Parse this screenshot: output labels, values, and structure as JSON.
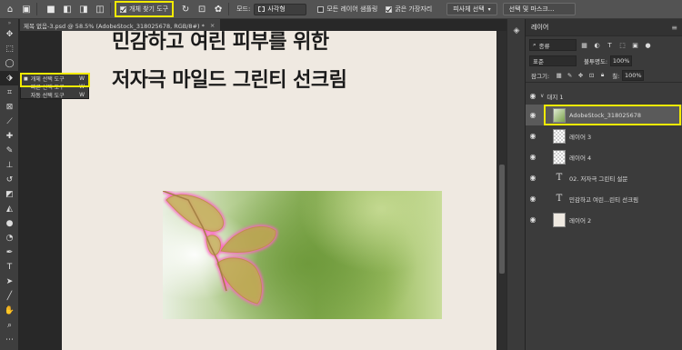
{
  "options_bar": {
    "object_finder_label": "개체 찾기 도구",
    "mode_label": "모드:",
    "mode_value": "사각형",
    "sample_all_layers_label": "모든 레이어 샘플링",
    "hard_edge_label": "굵은 가장자리",
    "subject_select_label": "피사체 선택",
    "select_mask_label": "선택 및 마스크..."
  },
  "document_tab": {
    "title": "제목 없음-3.psd @ 58.5% (AdobeStock_318025678, RGB/8#) *"
  },
  "tool_flyout": {
    "items": [
      {
        "label": "개체 선택 도구",
        "key": "W"
      },
      {
        "label": "빠른 선택 도구",
        "key": "W"
      },
      {
        "label": "자동 선택 도구",
        "key": "W"
      }
    ]
  },
  "canvas": {
    "line1": "민감하고 여린 피부를 위한",
    "line2": "저자극 마일드 그린티 선크림"
  },
  "layers_panel": {
    "tab": "레이어",
    "kind_filter": "종류",
    "blend_mode": "표준",
    "opacity_label": "불투명도:",
    "opacity_value": "100%",
    "lock_label": "잠그기:",
    "fill_label": "칠:",
    "fill_value": "100%",
    "layers": [
      {
        "name": "대지 1",
        "type": "group"
      },
      {
        "name": "AdobeStock_318025678",
        "type": "image",
        "selected": true
      },
      {
        "name": "레이어 3",
        "type": "pixel"
      },
      {
        "name": "레이어 4",
        "type": "pixel"
      },
      {
        "name": "02. 저자극 그린티 설문",
        "type": "text"
      },
      {
        "name": "민감하고 여린...린티 선크림",
        "type": "text"
      },
      {
        "name": "레이어 2",
        "type": "fill"
      }
    ]
  },
  "colors": {
    "highlight": "#f2ea00",
    "selection_glow": "#ff5ec4",
    "canvas_bg": "#efe9e1"
  }
}
